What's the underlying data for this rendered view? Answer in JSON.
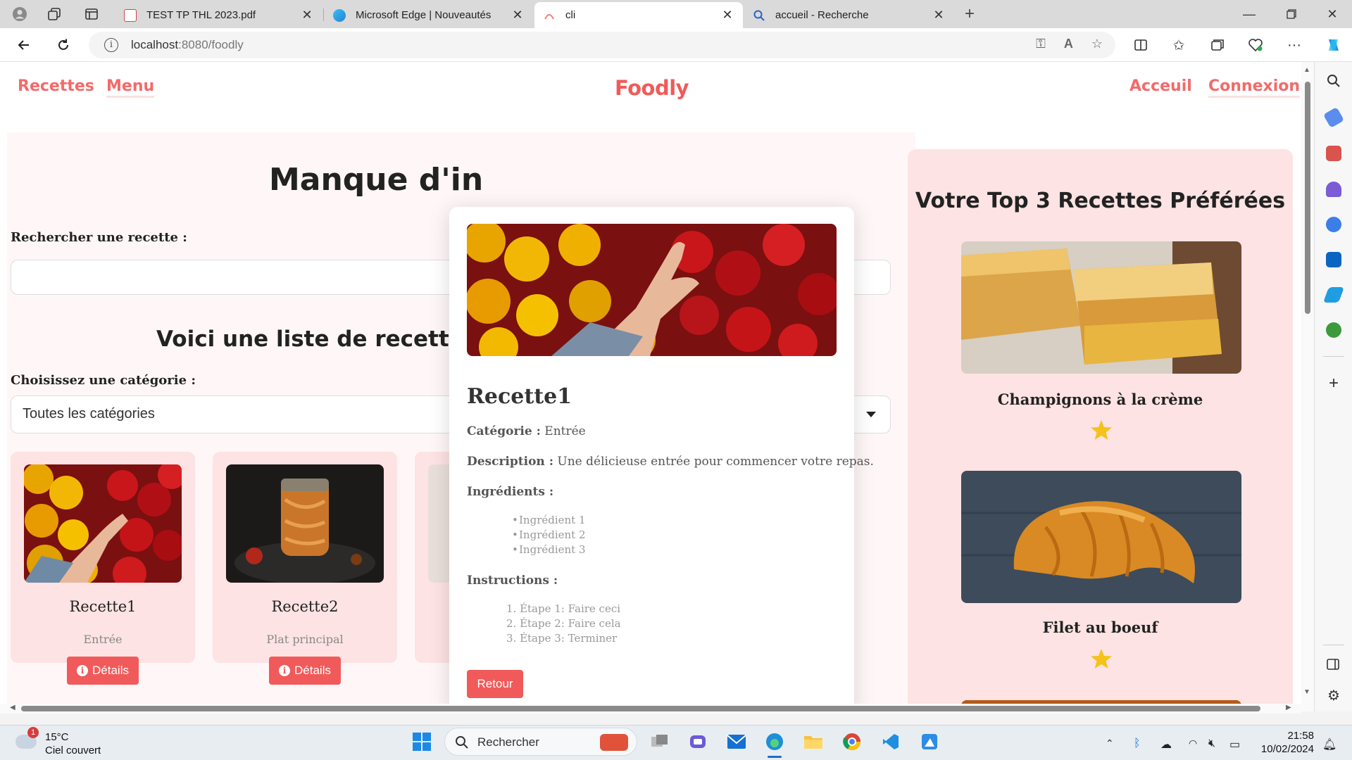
{
  "browser": {
    "tabs": [
      {
        "label": "TEST TP THL 2023.pdf",
        "active": false
      },
      {
        "label": "Microsoft Edge | Nouveautés",
        "active": false
      },
      {
        "label": "cli",
        "active": true
      },
      {
        "label": "accueil - Recherche",
        "active": false
      }
    ],
    "url_host": "localhost",
    "url_rest": ":8080/foodly"
  },
  "site": {
    "nav_left": [
      "Recettes",
      "Menu"
    ],
    "brand": "Foodly",
    "nav_right": [
      "Acceuil",
      "Connexion"
    ]
  },
  "main": {
    "hero_title": "Manque d'in",
    "search_label": "Rechercher une recette :",
    "list_title": "Voici une liste de recettes p",
    "category_label": "Choisissez une catégorie :",
    "category_value": "Toutes les catégories",
    "details_label": "Détails",
    "cards": [
      {
        "name": "Recette1",
        "category": "Entrée"
      },
      {
        "name": "Recette2",
        "category": "Plat principal"
      }
    ]
  },
  "top3": {
    "title": "Votre Top 3 Recettes Préférées",
    "items": [
      {
        "name": "Champignons à la crème",
        "stars": 1
      },
      {
        "name": "Filet au boeuf",
        "stars": 1
      }
    ]
  },
  "modal": {
    "title": "Recette1",
    "category_label": "Catégorie :",
    "category_value": "Entrée",
    "description_label": "Description :",
    "description_value": "Une délicieuse entrée pour commencer votre repas.",
    "ingredients_label": "Ingrédients :",
    "ingredients": [
      "Ingrédient 1",
      "Ingrédient 2",
      "Ingrédient 3"
    ],
    "instructions_label": "Instructions :",
    "instructions": [
      "1. Étape 1: Faire ceci",
      "2. Étape 2: Faire cela",
      "3. Étape 3: Terminer"
    ],
    "back_label": "Retour"
  },
  "taskbar": {
    "weather_badge": "1",
    "temperature": "15°C",
    "condition": "Ciel couvert",
    "search_placeholder": "Rechercher",
    "time": "21:58",
    "date": "10/02/2024"
  },
  "colors": {
    "accent": "#f15a5a",
    "card_bg": "#fde3e3"
  }
}
